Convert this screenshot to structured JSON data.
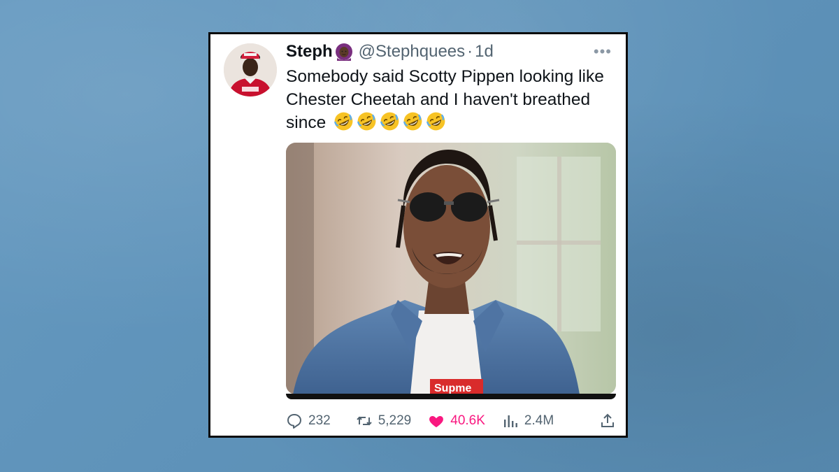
{
  "tweet": {
    "display_name": "Steph",
    "handle": "@Stephquees",
    "separator": "·",
    "time": "1d",
    "more": "•••",
    "text": "Somebody said Scotty Pippen looking like Chester Cheetah and I haven't breathed since",
    "emoji_count": 5,
    "emoji_name": "rolling-on-the-floor-laughing",
    "media_alt_text": "Supme"
  },
  "metrics": {
    "replies": "232",
    "retweets": "5,229",
    "likes": "40.6K",
    "views": "2.4M"
  },
  "colors": {
    "background": "#5d94bd",
    "like_accent": "#f91880",
    "text_primary": "#0f1419",
    "text_secondary": "#536471"
  }
}
